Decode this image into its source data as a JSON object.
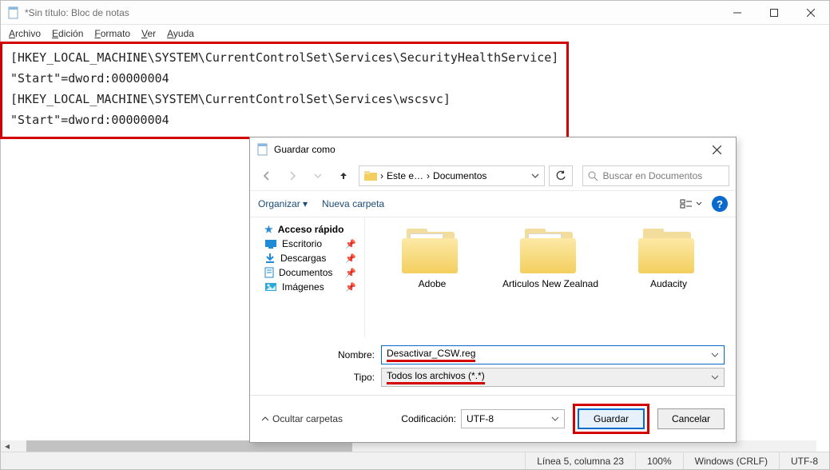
{
  "notepad": {
    "title": "*Sin título: Bloc de notas",
    "menu": {
      "file": "Archivo",
      "edit": "Edición",
      "format": "Formato",
      "view": "Ver",
      "help": "Ayuda"
    },
    "content_lines": [
      "[HKEY_LOCAL_MACHINE\\SYSTEM\\CurrentControlSet\\Services\\SecurityHealthService]",
      "\"Start\"=dword:00000004",
      "",
      "[HKEY_LOCAL_MACHINE\\SYSTEM\\CurrentControlSet\\Services\\wscsvc]",
      "\"Start\"=dword:00000004"
    ],
    "status": {
      "position": "Línea 5, columna 23",
      "zoom": "100%",
      "eol": "Windows (CRLF)",
      "encoding": "UTF-8"
    }
  },
  "dialog": {
    "title": "Guardar como",
    "breadcrumb": {
      "root": "Este e…",
      "folder": "Documentos"
    },
    "search_placeholder": "Buscar en Documentos",
    "toolbar": {
      "organize": "Organizar",
      "new_folder": "Nueva carpeta"
    },
    "tree": {
      "quick_access": "Acceso rápido",
      "items": [
        {
          "label": "Escritorio",
          "icon": "desktop",
          "color": "#1f8ad6"
        },
        {
          "label": "Descargas",
          "icon": "download",
          "color": "#1f8ad6"
        },
        {
          "label": "Documentos",
          "icon": "document",
          "color": "#1f8ad6"
        },
        {
          "label": "Imágenes",
          "icon": "image",
          "color": "#2aa8d8"
        }
      ]
    },
    "folders": [
      {
        "name": "Adobe"
      },
      {
        "name": "Articulos New Zealnad"
      },
      {
        "name": "Audacity"
      }
    ],
    "fields": {
      "name_label": "Nombre:",
      "name_value": "Desactivar_CSW.reg",
      "type_label": "Tipo:",
      "type_value": "Todos los archivos  (*.*)",
      "encoding_label": "Codificación:",
      "encoding_value": "UTF-8"
    },
    "buttons": {
      "hide_folders": "Ocultar carpetas",
      "save": "Guardar",
      "cancel": "Cancelar"
    }
  }
}
